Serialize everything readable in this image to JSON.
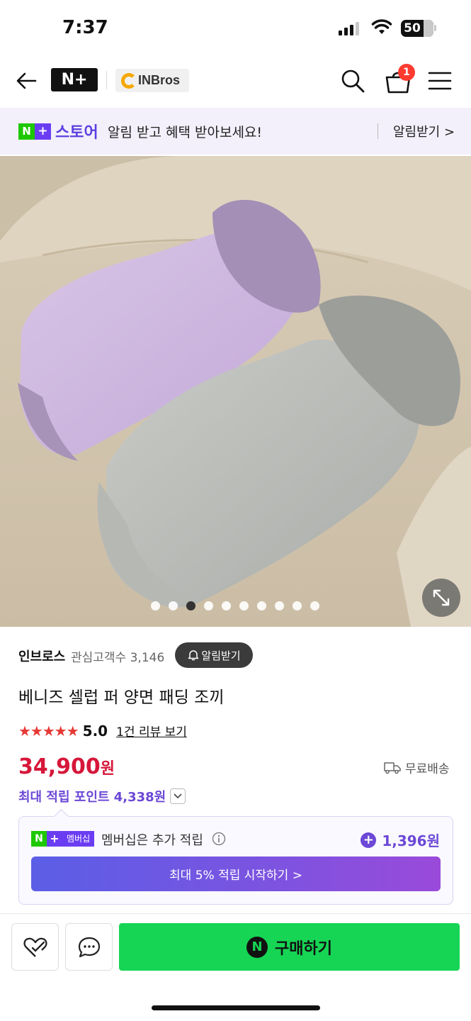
{
  "status_bar": {
    "time": "7:37",
    "battery": "50"
  },
  "header": {
    "logo_text": "N+",
    "brand_name": "INBros",
    "cart_count": "1",
    "icons": [
      "back-arrow-icon",
      "search-icon",
      "cart-icon",
      "menu-icon"
    ]
  },
  "store_banner": {
    "badge": "N+",
    "store_word": "스토어",
    "message": "알림 받고 혜택 받아보세요!",
    "link": "알림받기 >"
  },
  "gallery": {
    "image_count": 10,
    "active_index": 2
  },
  "seller": {
    "name": "인브로스",
    "followers": "관심고객수 3,146",
    "notify_button": "알림받기"
  },
  "product": {
    "title": "베니즈 셀럽 퍼 양면 패딩 조끼",
    "stars": "★★★★★",
    "rating": "5.0",
    "reviews_link": "1건 리뷰 보기",
    "price": "34,900",
    "price_unit": "원",
    "shipping": "무료배송",
    "max_points": "최대 적립 포인트 4,338원"
  },
  "membership": {
    "badge_label": "멤버십",
    "text": "멤버십은 추가 적립",
    "points": "1,396원",
    "cta": "최대 5% 적립 시작하기 >"
  },
  "bottom_bar": {
    "buy_label": "구매하기",
    "buy_icon": "N"
  },
  "colors": {
    "price_red": "#d6173a",
    "accent_purple": "#6b48d6",
    "buy_green": "#16d554",
    "naver_green": "#1ec800",
    "star_red": "#e53935"
  }
}
